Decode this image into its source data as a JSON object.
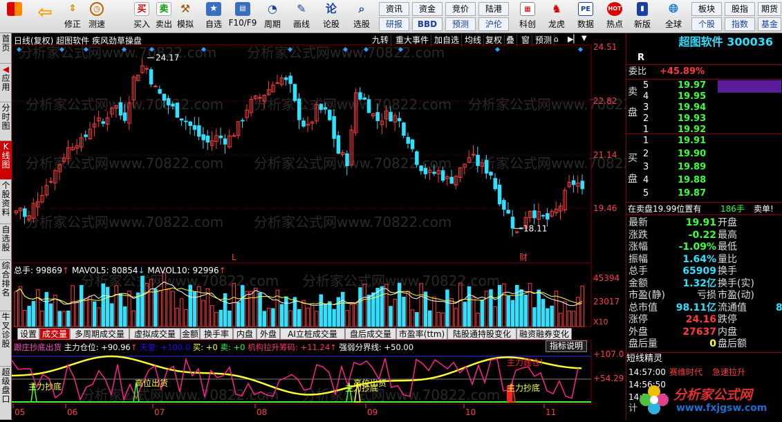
{
  "toolbar": {
    "left_buttons": [
      {
        "label": "",
        "icon": "grid-icon"
      },
      {
        "label": "",
        "icon": "back-arrow-icon"
      },
      {
        "label": "修正",
        "icon": "arrows-icon"
      },
      {
        "label": "测速",
        "icon": "clock-icon"
      },
      {
        "label": "买入",
        "icon": "buy-icon",
        "glyph": "买"
      },
      {
        "label": "卖出",
        "icon": "sell-icon",
        "glyph": "卖"
      },
      {
        "label": "模拟",
        "icon": "hammer-icon"
      },
      {
        "label": "自选",
        "icon": "star-icon"
      },
      {
        "label": "F10/F9",
        "icon": "screen-icon"
      },
      {
        "label": "周期",
        "icon": "cycle-icon"
      },
      {
        "label": "画线",
        "icon": "pen-icon"
      },
      {
        "label": "论股",
        "icon": "talk-icon",
        "glyph": "论"
      },
      {
        "label": "选股",
        "icon": "magnifier-icon"
      }
    ],
    "small_grid": [
      [
        "资讯",
        "资金",
        "竞价",
        "陆港"
      ],
      [
        "研报",
        "BBD",
        "预测",
        "沪伦"
      ]
    ],
    "right_buttons": [
      {
        "label": "科创",
        "icon": "kechuang-icon"
      },
      {
        "label": "龙虎",
        "icon": "dragon-icon"
      },
      {
        "label": "数据",
        "icon": "pe-icon",
        "glyph": "PE"
      },
      {
        "label": "热点",
        "icon": "hot-icon",
        "glyph": "HOT"
      },
      {
        "label": "新版",
        "icon": "new-icon"
      },
      {
        "label": "全球",
        "icon": "globe-icon"
      }
    ],
    "far_right_grid": [
      [
        "板块",
        "股指",
        "期货"
      ],
      [
        "个股",
        "指数",
        "基金"
      ]
    ]
  },
  "left_tabs": [
    "首页",
    "应用",
    "分时图",
    "K线图",
    "个股资料",
    "自选股",
    "综合排名",
    "牛叉诊股",
    "超级盘口"
  ],
  "chart_header": {
    "title": "日线(复权)  超图软件  疾风劲草操盘",
    "buttons": [
      "九转",
      "重大事件",
      "加自选",
      "均线",
      "复权",
      "叠",
      "窗",
      "预测"
    ]
  },
  "price_axis": [
    "24.51",
    "22.82",
    "21.14",
    "19.46"
  ],
  "price_annotations": {
    "high": "24.17",
    "low": "18.11",
    "marker_l": "L",
    "marker_cai": "财"
  },
  "volume": {
    "legend_total": "总手: 99869",
    "legend_ma5": "MAVOL5: 80854",
    "legend_ma10": "MAVOL10: 92996",
    "axis": [
      "45394",
      "23017"
    ],
    "unit": "X10"
  },
  "indicator_tabs": [
    "设置",
    "成交量",
    "多周期成交量",
    "虚拟成交量",
    "金额",
    "换手率",
    "内盘",
    "外盘",
    "AI立桩成交量",
    "盘后成交量",
    "市盈率(ttm)",
    "陆股通持股变化",
    "融资融券变化"
  ],
  "sub_indicator": {
    "legend_name": "跟庄抄底出货",
    "legend_pos": "主力仓位: +90.96",
    "legend_tiantang": "天堂: +100.0",
    "legend_buy": "买: +0",
    "legend_sell": "卖: +0",
    "legend_jigou": "机构拉升筹码: +11.24",
    "legend_ruoqiang": "强弱分界线: +50.00",
    "help_button": "指标说明",
    "axis": [
      "+107.0",
      "+54.29"
    ],
    "annotations": [
      "主力抄底",
      "高位出货",
      "高位出货",
      "主力抄底",
      "主力抄底",
      "主力建仓!"
    ]
  },
  "x_axis": [
    "05",
    "06",
    "07",
    "08",
    "09",
    "10",
    "11"
  ],
  "watermark": "分析家公式网www.70822.com",
  "right_panel": {
    "stock_name": "超图软件 300036",
    "flag": "R",
    "weibi_label": "委比",
    "weibi_value": "+45.89%",
    "sell_label": "卖盘",
    "buy_label": "买盘",
    "sell_levels": [
      {
        "level": "5",
        "price": "19.97"
      },
      {
        "level": "4",
        "price": "19.95"
      },
      {
        "level": "3",
        "price": "19.94"
      },
      {
        "level": "2",
        "price": "19.93"
      },
      {
        "level": "1",
        "price": "19.92"
      }
    ],
    "buy_levels": [
      {
        "level": "1",
        "price": "19.91"
      },
      {
        "level": "2",
        "price": "19.90"
      },
      {
        "level": "3",
        "price": "19.89"
      },
      {
        "level": "4",
        "price": "19.88"
      },
      {
        "level": "5",
        "price": "19.87"
      }
    ],
    "status_line": {
      "text": "在卖盘19.99位置有",
      "qty": "186手",
      "action": "卖单!"
    },
    "quote_rows": [
      {
        "l1": "最新",
        "v1": "19.91",
        "c1": "grn",
        "l2": "开盘",
        "v2": ""
      },
      {
        "l1": "涨跌",
        "v1": "-0.22",
        "c1": "grn",
        "l2": "最高",
        "v2": ""
      },
      {
        "l1": "涨幅",
        "v1": "-1.09%",
        "c1": "grn",
        "l2": "最低",
        "v2": ""
      },
      {
        "l1": "振幅",
        "v1": "1.64%",
        "c1": "cyan",
        "l2": "量比",
        "v2": ""
      },
      {
        "l1": "总手",
        "v1": "65909",
        "c1": "cyan",
        "l2": "换手",
        "v2": ""
      },
      {
        "l1": "金额",
        "v1": "1.32亿",
        "c1": "cyan",
        "l2": "换手(实)",
        "v2": ""
      },
      {
        "l1": "市盈(静)",
        "v1": "亏损",
        "c1": "lbl-w",
        "l2": "市盈(动)",
        "v2": ""
      },
      {
        "l1": "总市值",
        "v1": "98.11亿",
        "c1": "cyan",
        "l2": "流通值",
        "v2": "8"
      },
      {
        "l1": "涨停",
        "v1": "24.16",
        "c1": "red",
        "l2": "跌停",
        "v2": ""
      },
      {
        "l1": "外盘",
        "v1": "27637",
        "c1": "red",
        "l2": "内盘",
        "v2": ""
      },
      {
        "l1": "盘后量",
        "v1": "0",
        "c1": "yel",
        "l2": "盘后额",
        "v2": ""
      }
    ],
    "section_title": "短线精灵",
    "spirit_rows": [
      {
        "time": "14:57:00",
        "name": "赛维时代",
        "event": "急速拉升"
      },
      {
        "time": "14:56:50",
        "name": "",
        "event": ""
      },
      {
        "time": "14:56:47",
        "name": "",
        "event": ""
      }
    ],
    "bottom_label": "计",
    "brand_logo": {
      "cn": "分析家公式网",
      "url": "www.fxjgsw.com"
    }
  },
  "colors": {
    "up": "#ff3c3c",
    "down": "#30e0ff",
    "grid": "#800000",
    "axis_text": "#ff4040"
  }
}
